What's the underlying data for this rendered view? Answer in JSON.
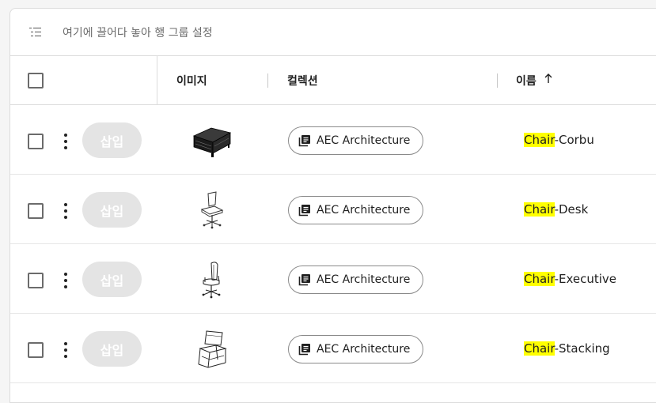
{
  "group_bar": {
    "icon": "group-rows-icon",
    "placeholder": "여기에 끌어다 놓아 행 그룹 설정"
  },
  "columns": [
    {
      "key": "select",
      "label": ""
    },
    {
      "key": "image",
      "label": "이미지"
    },
    {
      "key": "collection",
      "label": "컬렉션"
    },
    {
      "key": "name",
      "label": "이름",
      "sort": "ascending"
    }
  ],
  "search_highlight": "Chair",
  "rows": [
    {
      "insert_label": "삽입",
      "collection": "AEC Architecture",
      "name_match": "Chair",
      "name_rest": "-Corbu",
      "thumbnail": "armchair-thumbnail"
    },
    {
      "insert_label": "삽입",
      "collection": "AEC Architecture",
      "name_match": "Chair",
      "name_rest": "-Desk",
      "thumbnail": "desk-chair-thumbnail"
    },
    {
      "insert_label": "삽입",
      "collection": "AEC Architecture",
      "name_match": "Chair",
      "name_rest": "-Executive",
      "thumbnail": "executive-chair-thumbnail"
    },
    {
      "insert_label": "삽입",
      "collection": "AEC Architecture",
      "name_match": "Chair",
      "name_rest": "-Stacking",
      "thumbnail": "stacking-chair-thumbnail"
    }
  ],
  "colors": {
    "highlight": "#ffff00",
    "insert_disabled_bg": "#e4e4e4",
    "border": "#dcdcdc"
  }
}
